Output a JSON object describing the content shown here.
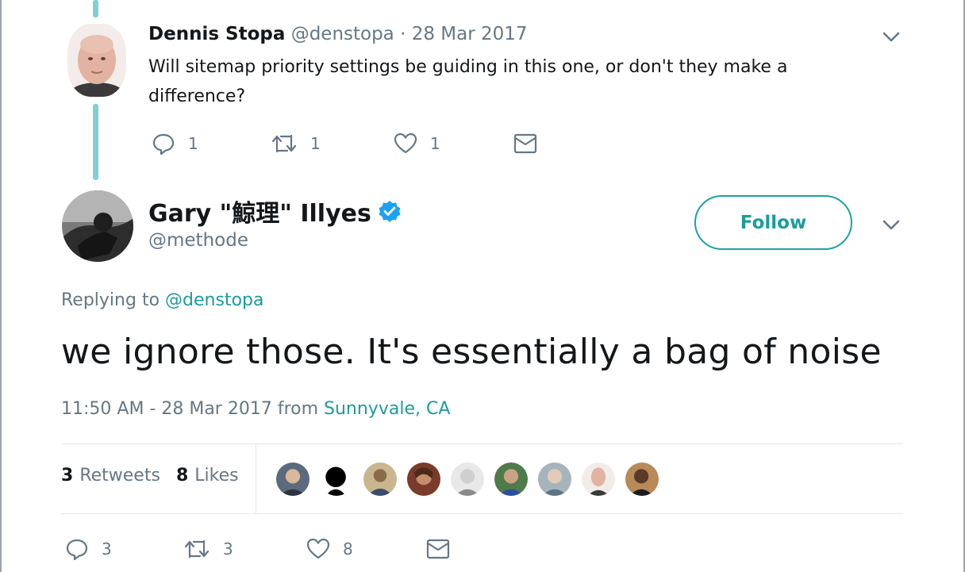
{
  "parent_tweet": {
    "name": "Dennis Stopa",
    "handle": "@denstopa",
    "separator": " · ",
    "date": "28 Mar 2017",
    "text": "Will sitemap priority settings be guiding in this one, or don't they make a difference?",
    "replies": "1",
    "retweets": "1",
    "likes": "1"
  },
  "main_tweet": {
    "name": "Gary \"鯨理\" Illyes",
    "handle": "@methode",
    "follow_label": "Follow",
    "replying_prefix": "Replying to ",
    "replying_to": "@denstopa",
    "text": "we ignore those. It's essentially a bag of noise",
    "time": "11:50 AM - 28 Mar 2017 from ",
    "location": "Sunnyvale, CA",
    "retweet_count": "3",
    "retweet_label": "Retweets",
    "like_count": "8",
    "like_label": "Likes",
    "replies": "3",
    "retweets": "3",
    "likes": "8"
  },
  "icons": {
    "reply": "reply-icon",
    "retweet": "retweet-icon",
    "like": "heart-icon",
    "dm": "envelope-icon",
    "chevron": "chevron-down-icon",
    "verified": "verified-badge-icon"
  },
  "colors": {
    "accent": "#1b9c9c",
    "thread_line": "#7fd0d0",
    "muted": "#657786",
    "text": "#14171a",
    "verified": "#1da1f2"
  }
}
